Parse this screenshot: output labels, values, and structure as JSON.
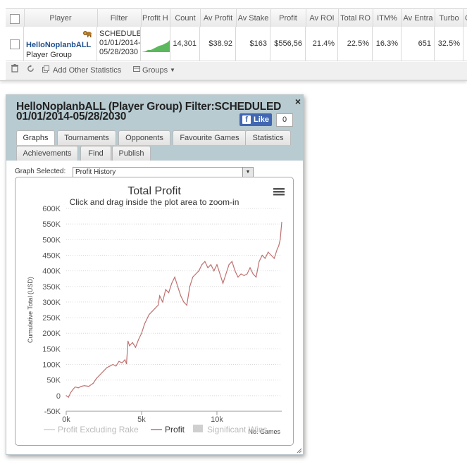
{
  "table": {
    "headers": [
      "Player",
      "Filter",
      "Profit H",
      "Count",
      "Av Profit",
      "Av Stake",
      "Profit",
      "Av ROI",
      "Total RO",
      "ITM%",
      "Av Entra",
      "Turbo",
      "C"
    ],
    "row": {
      "player_name": "HelloNoplanbALL",
      "player_group": "Player Group",
      "filter_line1": "SCHEDULED",
      "filter_line2": "01/01/2014-",
      "filter_line3": "05/28/2030",
      "count": "14,301",
      "av_profit": "$38.92",
      "av_stake": "$163",
      "profit": "$556,56",
      "av_roi": "21.4%",
      "total_roi": "22.5%",
      "itm": "16.3%",
      "av_entrants": "651",
      "turbo": "32.5%"
    }
  },
  "toolbar": {
    "add_stats": "Add Other Statistics",
    "groups": "Groups"
  },
  "dialog": {
    "title_line1": "HelloNoplanbALL (Player Group) Filter:SCHEDULED",
    "title_line2": "01/01/2014-05/28/2030",
    "close": "×",
    "like": "Like",
    "like_count": "0",
    "tabs_row1": [
      "Graphs",
      "Tournaments",
      "Opponents",
      "Favourite Games",
      "Statistics"
    ],
    "tabs_row2": [
      "Achievements",
      "Find",
      "Publish"
    ],
    "active_tab": "Graphs",
    "graph_selected_label": "Graph Selected:",
    "graph_selected_value": "Profit History"
  },
  "chart_data": {
    "type": "line",
    "title": "Total Profit",
    "subtitle": "Click and drag inside the plot area to zoom-in",
    "ylabel": "Cumulative Total (USD)",
    "xlabel": "No. Games",
    "xlim": [
      0,
      14301
    ],
    "ylim": [
      -50000,
      600000
    ],
    "y_ticks": [
      "-50K",
      "0",
      "50K",
      "100K",
      "150K",
      "200K",
      "250K",
      "300K",
      "350K",
      "400K",
      "450K",
      "500K",
      "550K",
      "600K"
    ],
    "x_ticks": [
      "0k",
      "5k",
      "10k"
    ],
    "legend": [
      "Profit Excluding Rake",
      "Profit",
      "Significant Wins"
    ],
    "legend_placement": "bottom",
    "grid": true,
    "series": [
      {
        "name": "Profit",
        "color": "#c07070",
        "x": [
          0,
          150,
          300,
          450,
          600,
          800,
          1000,
          1200,
          1500,
          1800,
          2000,
          2200,
          2500,
          2700,
          2900,
          3100,
          3300,
          3500,
          3700,
          3900,
          4000,
          4100,
          4200,
          4400,
          4600,
          4800,
          5000,
          5200,
          5400,
          5500,
          5700,
          5900,
          6100,
          6200,
          6400,
          6600,
          6800,
          7000,
          7200,
          7400,
          7600,
          7800,
          8000,
          8200,
          8400,
          8600,
          8800,
          9000,
          9200,
          9400,
          9600,
          9800,
          10000,
          10200,
          10400,
          10600,
          10800,
          11000,
          11200,
          11400,
          11600,
          11800,
          12000,
          12200,
          12400,
          12600,
          12800,
          13000,
          13200,
          13400,
          13600,
          13800,
          14000,
          14100,
          14200,
          14301
        ],
        "values": [
          0,
          -5000,
          10000,
          20000,
          28000,
          25000,
          30000,
          32000,
          30000,
          40000,
          55000,
          65000,
          80000,
          90000,
          95000,
          100000,
          95000,
          110000,
          105000,
          115000,
          102000,
          175000,
          160000,
          170000,
          155000,
          180000,
          200000,
          230000,
          250000,
          260000,
          270000,
          280000,
          290000,
          320000,
          300000,
          340000,
          330000,
          360000,
          380000,
          350000,
          320000,
          300000,
          290000,
          350000,
          380000,
          390000,
          400000,
          420000,
          430000,
          410000,
          420000,
          400000,
          420000,
          390000,
          360000,
          390000,
          420000,
          430000,
          400000,
          380000,
          390000,
          385000,
          390000,
          410000,
          390000,
          380000,
          430000,
          450000,
          440000,
          460000,
          450000,
          440000,
          470000,
          480000,
          500000,
          556000
        ]
      }
    ]
  }
}
